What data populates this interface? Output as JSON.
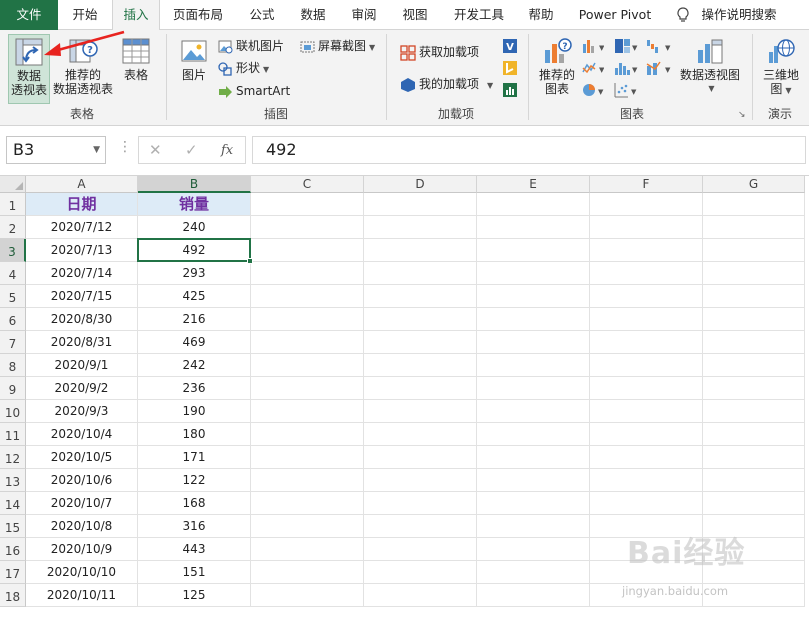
{
  "tabs": [
    {
      "label": "文件"
    },
    {
      "label": "开始"
    },
    {
      "label": "插入"
    },
    {
      "label": "页面布局"
    },
    {
      "label": "公式"
    },
    {
      "label": "数据"
    },
    {
      "label": "审阅"
    },
    {
      "label": "视图"
    },
    {
      "label": "开发工具"
    },
    {
      "label": "帮助"
    },
    {
      "label": "Power Pivot"
    },
    {
      "label": "操作说明搜索"
    }
  ],
  "ribbon": {
    "tables": {
      "pivot_line1": "数据",
      "pivot_line2": "透视表",
      "recommended_line1": "推荐的",
      "recommended_line2": "数据透视表",
      "table": "表格",
      "group": "表格"
    },
    "illustrations": {
      "picture": "图片",
      "online_picture": "联机图片",
      "shapes": "形状",
      "smartart": "SmartArt",
      "screenshot": "屏幕截图",
      "group": "插图"
    },
    "addins": {
      "get": "获取加载项",
      "mine": "我的加载项",
      "group": "加载项"
    },
    "charts": {
      "recommended_line1": "推荐的",
      "recommended_line2": "图表",
      "pivot_chart": "数据透视图",
      "group": "图表"
    },
    "tours": {
      "map_line1": "三维地",
      "map_line2": "图",
      "group": "演示"
    }
  },
  "formula_bar": {
    "name_box": "B3",
    "fx": "fx",
    "value": "492"
  },
  "columns": [
    "A",
    "B",
    "C",
    "D",
    "E",
    "F",
    "G"
  ],
  "rows": [
    "1",
    "2",
    "3",
    "4",
    "5",
    "6",
    "7",
    "8",
    "9",
    "10",
    "11",
    "12",
    "13",
    "14",
    "15",
    "16",
    "17",
    "18"
  ],
  "table": {
    "headers": [
      "日期",
      "销量"
    ],
    "data": [
      [
        "2020/7/12",
        "240"
      ],
      [
        "2020/7/13",
        "492"
      ],
      [
        "2020/7/14",
        "293"
      ],
      [
        "2020/7/15",
        "425"
      ],
      [
        "2020/8/30",
        "216"
      ],
      [
        "2020/8/31",
        "469"
      ],
      [
        "2020/9/1",
        "242"
      ],
      [
        "2020/9/2",
        "236"
      ],
      [
        "2020/9/3",
        "190"
      ],
      [
        "2020/10/4",
        "180"
      ],
      [
        "2020/10/5",
        "171"
      ],
      [
        "2020/10/6",
        "122"
      ],
      [
        "2020/10/7",
        "168"
      ],
      [
        "2020/10/8",
        "316"
      ],
      [
        "2020/10/9",
        "443"
      ],
      [
        "2020/10/10",
        "151"
      ],
      [
        "2020/10/11",
        "125"
      ]
    ]
  },
  "watermark": {
    "brand": "Bai经验",
    "url": "jingyan.baidu.com"
  },
  "colors": {
    "excel_green": "#217346",
    "header_fill": "#ddebf7",
    "header_text": "#7030a0",
    "annotation_arrow": "#e8231f"
  }
}
